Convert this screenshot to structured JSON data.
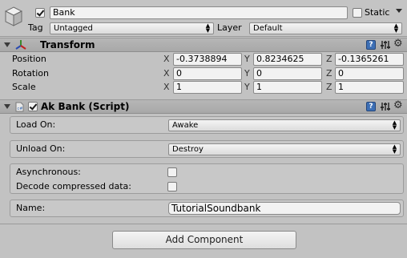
{
  "gameobject": {
    "active_checked": true,
    "name": "Bank",
    "static_label": "Static",
    "tag_label": "Tag",
    "tag_value": "Untagged",
    "layer_label": "Layer",
    "layer_value": "Default"
  },
  "transform": {
    "title": "Transform",
    "rows": [
      {
        "label": "Position",
        "x": "-0.3738894",
        "y": "0.8234625",
        "z": "-0.1365261"
      },
      {
        "label": "Rotation",
        "x": "0",
        "y": "0",
        "z": "0"
      },
      {
        "label": "Scale",
        "x": "1",
        "y": "1",
        "z": "1"
      }
    ],
    "axis_x": "X",
    "axis_y": "Y",
    "axis_z": "Z"
  },
  "ak_bank": {
    "enabled": true,
    "title": "Ak Bank (Script)",
    "load_on_label": "Load On:",
    "load_on_value": "Awake",
    "unload_on_label": "Unload On:",
    "unload_on_value": "Destroy",
    "asynchronous_label": "Asynchronous:",
    "decode_label": "Decode compressed data:",
    "name_label": "Name:",
    "name_value": "TutorialSoundbank"
  },
  "add_component_label": "Add Component",
  "icons": {
    "gameobject": "cube-icon",
    "transform": "transform-axes-icon",
    "script": "script-file-icon",
    "help": "help-book-icon",
    "preset": "preset-sliders-icon",
    "settings": "gear-icon"
  }
}
